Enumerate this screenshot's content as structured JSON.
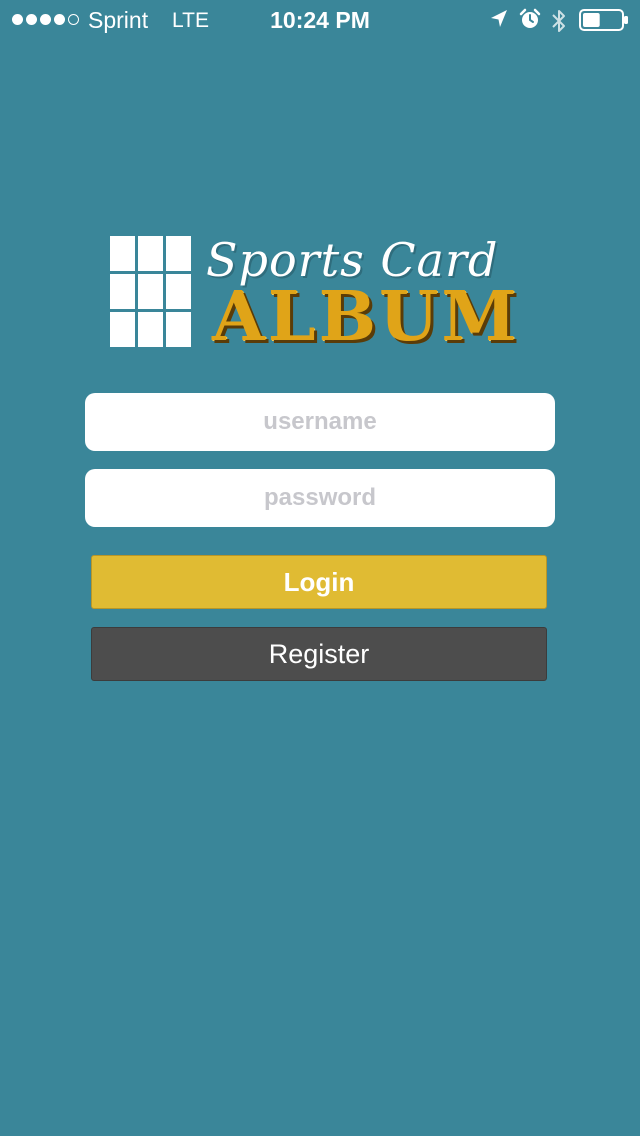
{
  "status_bar": {
    "carrier": "Sprint",
    "network": "LTE",
    "time": "10:24 PM",
    "signal_bars_filled": 4,
    "signal_bars_total": 5,
    "battery_level": 0.45,
    "icons": [
      "location-arrow-icon",
      "alarm-clock-icon",
      "bluetooth-icon",
      "battery-icon"
    ]
  },
  "logo": {
    "script_text": "Sports Card",
    "block_text": "ALBUM",
    "icon": "grid-icon"
  },
  "form": {
    "username_placeholder": "username",
    "password_placeholder": "password",
    "login_label": "Login",
    "register_label": "Register"
  },
  "colors": {
    "background": "#3a8699",
    "login_button": "#e0bb33",
    "register_button": "#4d4d4d",
    "album_gold": "#e0a418"
  }
}
